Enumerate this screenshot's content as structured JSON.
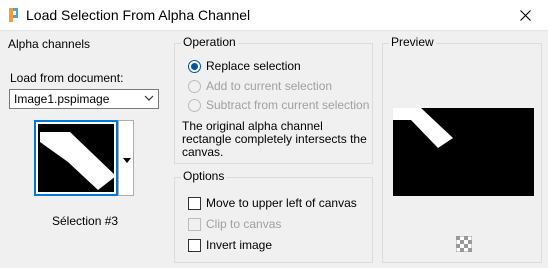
{
  "window": {
    "title": "Load Selection From Alpha Channel"
  },
  "alpha_channels": {
    "group_label": "Alpha channels",
    "load_from_label": "Load from document:",
    "document_value": "Image1.pspimage",
    "selection_name": "Sélection #3"
  },
  "operation": {
    "group_label": "Operation",
    "options": [
      {
        "label": "Replace selection",
        "checked": true,
        "enabled": true
      },
      {
        "label": "Add to current selection",
        "checked": false,
        "enabled": false
      },
      {
        "label": "Subtract from current selection",
        "checked": false,
        "enabled": false
      }
    ],
    "description_lines": [
      "The original alpha channel",
      "rectangle completely intersects the",
      "canvas."
    ]
  },
  "options": {
    "group_label": "Options",
    "move_label": "Move to upper left of canvas",
    "clip_label": "Clip to canvas",
    "invert_label": "Invert image"
  },
  "preview": {
    "group_label": "Preview"
  },
  "colors": {
    "accent": "#0078d7",
    "radio_checked": "#005499",
    "disabled_text": "#a0a0a0"
  }
}
